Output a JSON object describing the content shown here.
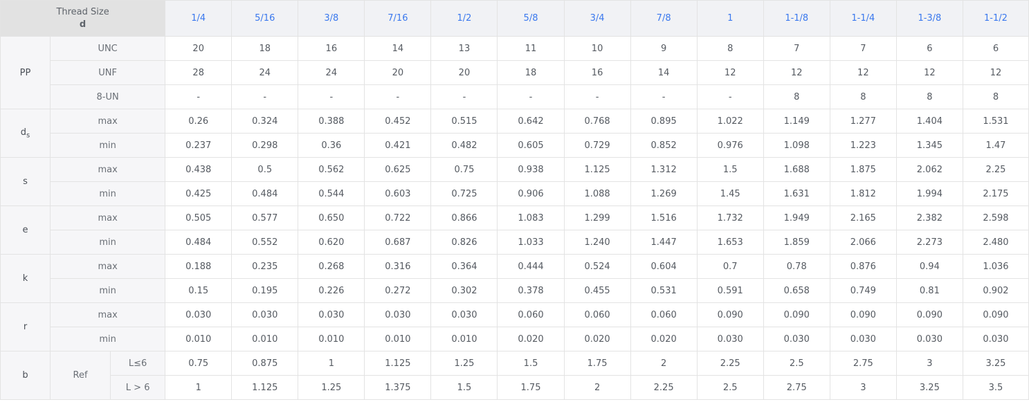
{
  "header": {
    "title": "Thread Size",
    "symbol": "d",
    "sizes": [
      "1/4",
      "5/16",
      "3/8",
      "7/16",
      "1/2",
      "5/8",
      "3/4",
      "7/8",
      "1",
      "1-1/8",
      "1-1/4",
      "1-3/8",
      "1-1/2"
    ]
  },
  "groups": [
    {
      "label": "PP",
      "label_sub": "",
      "rows": [
        {
          "label": "UNC",
          "values": [
            "20",
            "18",
            "16",
            "14",
            "13",
            "11",
            "10",
            "9",
            "8",
            "7",
            "7",
            "6",
            "6"
          ]
        },
        {
          "label": "UNF",
          "values": [
            "28",
            "24",
            "24",
            "20",
            "20",
            "18",
            "16",
            "14",
            "12",
            "12",
            "12",
            "12",
            "12"
          ]
        },
        {
          "label": "8-UN",
          "values": [
            "-",
            "-",
            "-",
            "-",
            "-",
            "-",
            "-",
            "-",
            "-",
            "8",
            "8",
            "8",
            "8"
          ]
        }
      ]
    },
    {
      "label": "d",
      "label_sub": "s",
      "rows": [
        {
          "label": "max",
          "values": [
            "0.26",
            "0.324",
            "0.388",
            "0.452",
            "0.515",
            "0.642",
            "0.768",
            "0.895",
            "1.022",
            "1.149",
            "1.277",
            "1.404",
            "1.531"
          ]
        },
        {
          "label": "min",
          "values": [
            "0.237",
            "0.298",
            "0.36",
            "0.421",
            "0.482",
            "0.605",
            "0.729",
            "0.852",
            "0.976",
            "1.098",
            "1.223",
            "1.345",
            "1.47"
          ]
        }
      ]
    },
    {
      "label": "s",
      "label_sub": "",
      "rows": [
        {
          "label": "max",
          "values": [
            "0.438",
            "0.5",
            "0.562",
            "0.625",
            "0.75",
            "0.938",
            "1.125",
            "1.312",
            "1.5",
            "1.688",
            "1.875",
            "2.062",
            "2.25"
          ]
        },
        {
          "label": "min",
          "values": [
            "0.425",
            "0.484",
            "0.544",
            "0.603",
            "0.725",
            "0.906",
            "1.088",
            "1.269",
            "1.45",
            "1.631",
            "1.812",
            "1.994",
            "2.175"
          ]
        }
      ]
    },
    {
      "label": "e",
      "label_sub": "",
      "rows": [
        {
          "label": "max",
          "values": [
            "0.505",
            "0.577",
            "0.650",
            "0.722",
            "0.866",
            "1.083",
            "1.299",
            "1.516",
            "1.732",
            "1.949",
            "2.165",
            "2.382",
            "2.598"
          ]
        },
        {
          "label": "min",
          "values": [
            "0.484",
            "0.552",
            "0.620",
            "0.687",
            "0.826",
            "1.033",
            "1.240",
            "1.447",
            "1.653",
            "1.859",
            "2.066",
            "2.273",
            "2.480"
          ]
        }
      ]
    },
    {
      "label": "k",
      "label_sub": "",
      "rows": [
        {
          "label": "max",
          "values": [
            "0.188",
            "0.235",
            "0.268",
            "0.316",
            "0.364",
            "0.444",
            "0.524",
            "0.604",
            "0.7",
            "0.78",
            "0.876",
            "0.94",
            "1.036"
          ]
        },
        {
          "label": "min",
          "values": [
            "0.15",
            "0.195",
            "0.226",
            "0.272",
            "0.302",
            "0.378",
            "0.455",
            "0.531",
            "0.591",
            "0.658",
            "0.749",
            "0.81",
            "0.902"
          ]
        }
      ]
    },
    {
      "label": "r",
      "label_sub": "",
      "rows": [
        {
          "label": "max",
          "values": [
            "0.030",
            "0.030",
            "0.030",
            "0.030",
            "0.030",
            "0.060",
            "0.060",
            "0.060",
            "0.090",
            "0.090",
            "0.090",
            "0.090",
            "0.090"
          ]
        },
        {
          "label": "min",
          "values": [
            "0.010",
            "0.010",
            "0.010",
            "0.010",
            "0.010",
            "0.020",
            "0.020",
            "0.020",
            "0.030",
            "0.030",
            "0.030",
            "0.030",
            "0.030"
          ]
        }
      ]
    },
    {
      "label": "b",
      "label_sub": "",
      "ref_label": "Ref",
      "rows": [
        {
          "label": "L≤6",
          "values": [
            "0.75",
            "0.875",
            "1",
            "1.125",
            "1.25",
            "1.5",
            "1.75",
            "2",
            "2.25",
            "2.5",
            "2.75",
            "3",
            "3.25"
          ]
        },
        {
          "label": "L > 6",
          "values": [
            "1",
            "1.125",
            "1.25",
            "1.375",
            "1.5",
            "1.75",
            "2",
            "2.25",
            "2.5",
            "2.75",
            "3",
            "3.25",
            "3.5"
          ]
        }
      ]
    }
  ]
}
